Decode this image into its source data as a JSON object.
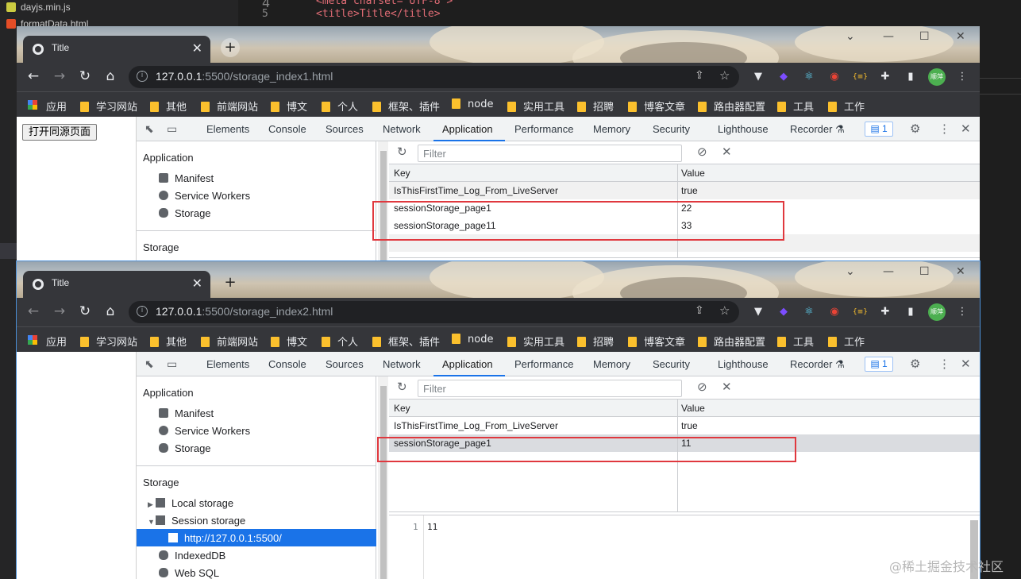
{
  "editor": {
    "files": [
      "dayjs.min.js",
      "formatData.html"
    ],
    "line_numbers": [
      "4",
      "5"
    ],
    "code_lines": [
      "<meta charset=\"UTF-8\">",
      "<title>Title</title>"
    ]
  },
  "windows": [
    {
      "tab_title": "Title",
      "url_host": "127.0.0.1",
      "url_rest": ":5500/storage_index1.html",
      "page_button": "打开同源页面",
      "table_rows": [
        {
          "key": "IsThisFirstTime_Log_From_LiveServer",
          "value": "true"
        },
        {
          "key": "sessionStorage_page1",
          "value": "22"
        },
        {
          "key": "sessionStorage_page11",
          "value": "33"
        }
      ]
    },
    {
      "tab_title": "Title",
      "url_host": "127.0.0.1",
      "url_rest": ":5500/storage_index2.html",
      "table_rows": [
        {
          "key": "IsThisFirstTime_Log_From_LiveServer",
          "value": "true"
        },
        {
          "key": "sessionStorage_page1",
          "value": "11"
        }
      ],
      "selected_origin": "http://127.0.0.1:5500/",
      "preview_line": "1",
      "preview_value": "11"
    }
  ],
  "bookmarks": [
    "应用",
    "学习网站",
    "其他",
    "前端网站",
    "博文",
    "个人",
    "框架、插件",
    "node",
    "实用工具",
    "招聘",
    "博客文章",
    "路由器配置",
    "工具",
    "工作"
  ],
  "profile_avatar": "顺萍",
  "devtools": {
    "tabs": [
      "Elements",
      "Console",
      "Sources",
      "Network",
      "Application",
      "Performance",
      "Memory",
      "Security",
      "Lighthouse",
      "Recorder"
    ],
    "selected_tab": "Application",
    "issues_count": "1",
    "filter_placeholder": "Filter",
    "col_key": "Key",
    "col_value": "Value",
    "sidebar": {
      "application_header": "Application",
      "items": [
        "Manifest",
        "Service Workers",
        "Storage"
      ],
      "storage_header": "Storage",
      "storage_items": [
        "Local storage",
        "Session storage"
      ],
      "db_items": [
        "IndexedDB",
        "Web SQL"
      ]
    }
  },
  "colors": {
    "accent": "#1a73e8",
    "highlight": "#e0383e",
    "chrome_dark": "#35363a"
  },
  "watermark": "@稀土掘金技术社区"
}
